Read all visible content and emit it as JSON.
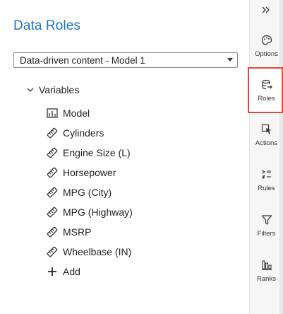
{
  "panel": {
    "title": "Data Roles",
    "model_select": {
      "value": "Data-driven content - Model 1"
    },
    "variables_header": "Variables",
    "variables": [
      {
        "label": "Model",
        "icon": "category-icon"
      },
      {
        "label": "Cylinders",
        "icon": "measure-icon"
      },
      {
        "label": "Engine Size (L)",
        "icon": "measure-icon"
      },
      {
        "label": "Horsepower",
        "icon": "measure-icon"
      },
      {
        "label": "MPG (City)",
        "icon": "measure-icon"
      },
      {
        "label": "MPG (Highway)",
        "icon": "measure-icon"
      },
      {
        "label": "MSRP",
        "icon": "measure-icon"
      },
      {
        "label": "Wheelbase (IN)",
        "icon": "measure-icon"
      }
    ],
    "add_label": "Add"
  },
  "rail": {
    "items": [
      {
        "label": "Options",
        "icon": "palette-icon"
      },
      {
        "label": "Roles",
        "icon": "roles-icon",
        "active": true
      },
      {
        "label": "Actions",
        "icon": "pointer-icon"
      },
      {
        "label": "Rules",
        "icon": "rules-icon"
      },
      {
        "label": "Filters",
        "icon": "filter-icon"
      },
      {
        "label": "Ranks",
        "icon": "ranks-icon"
      }
    ]
  },
  "colors": {
    "title": "#1f72c4",
    "active_outline": "#e14b3d",
    "rail_bg": "#f6f6f6"
  }
}
